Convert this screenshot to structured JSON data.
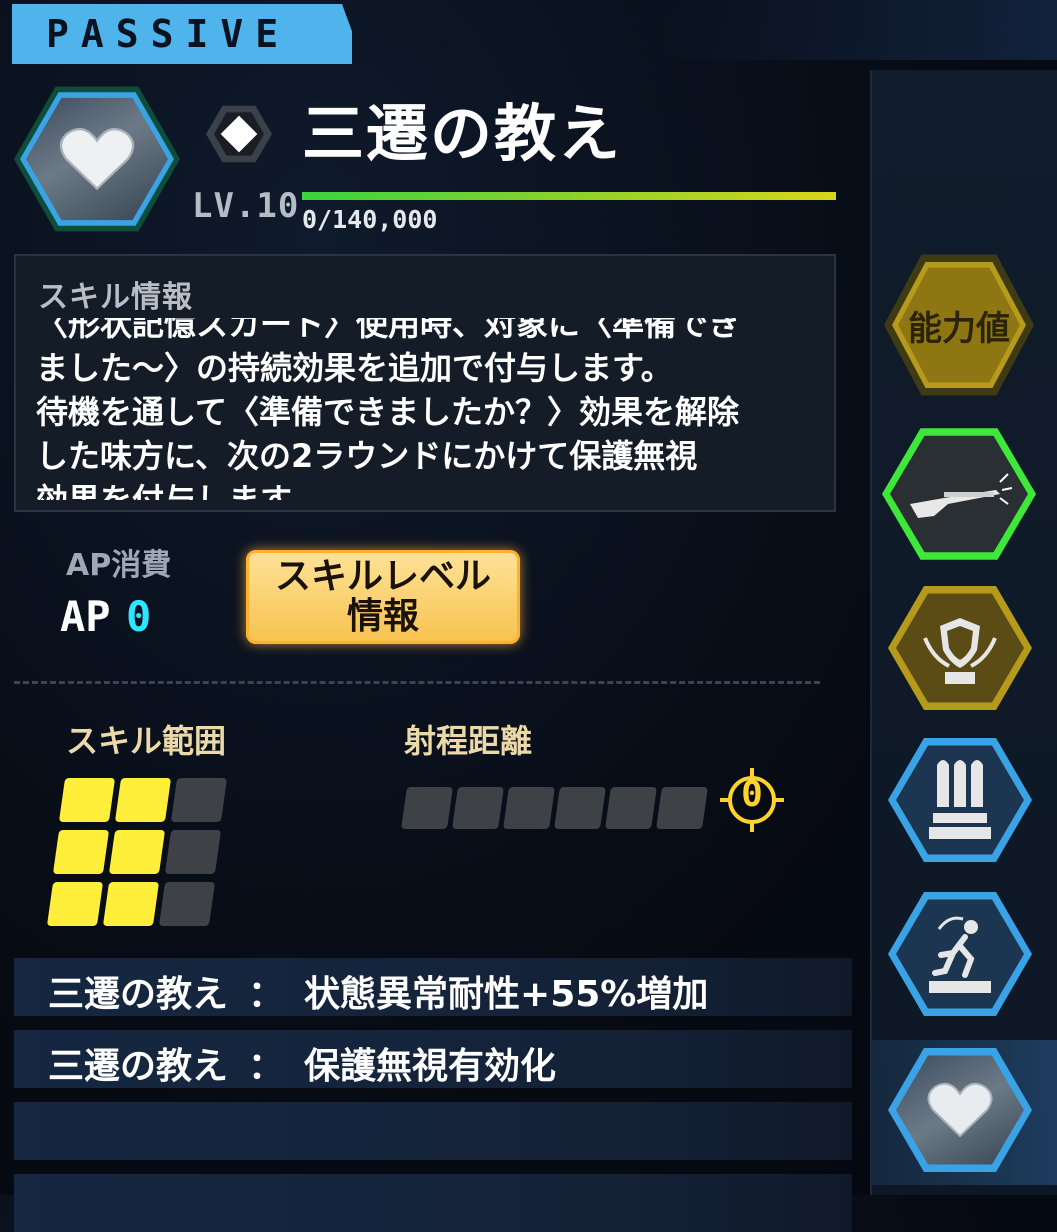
{
  "header": {
    "tab_label": "PASSIVE"
  },
  "skill": {
    "name": "三遷の教え",
    "level": "LV.10",
    "exp_text": "0/140,000",
    "exp_progress": 0
  },
  "info": {
    "title": "スキル情報",
    "lines": [
      "〈形状記憶スカート〉使用時、対象に〈準備でき",
      "ました〜〉の持続効果を追加で付与します。",
      "待機を通して〈準備できましたか？〉効果を解除",
      "した味方に、次の2ラウンドにかけて保護無視",
      "効果を付与します。"
    ]
  },
  "ap": {
    "label": "AP消費",
    "prefix": "AP",
    "value": "0"
  },
  "level_info_button": "スキルレベル情報",
  "range": {
    "label": "スキル範囲",
    "grid": [
      [
        1,
        1,
        0
      ],
      [
        1,
        1,
        0
      ],
      [
        1,
        1,
        0
      ]
    ]
  },
  "distance": {
    "label": "射程距離",
    "cells": 6,
    "value": "0"
  },
  "effects": [
    {
      "name": "三遷の教え",
      "sep": "：",
      "desc": "状態異常耐性+55%増加"
    },
    {
      "name": "三遷の教え",
      "sep": "：",
      "desc": "保護無視有効化"
    },
    {
      "name": "",
      "sep": "",
      "desc": ""
    },
    {
      "name": "",
      "sep": "",
      "desc": ""
    }
  ],
  "sidebar": {
    "items": [
      {
        "label": "能力値",
        "icon": "stats-icon",
        "color": "#b59a1c"
      },
      {
        "label": "",
        "icon": "shotgun-icon",
        "color": "#3ee83a"
      },
      {
        "label": "",
        "icon": "shield-wings-icon",
        "color": "#b59a1c"
      },
      {
        "label": "",
        "icon": "bullets-icon",
        "color": "#3aa3e6"
      },
      {
        "label": "",
        "icon": "running-icon",
        "color": "#3aa3e6"
      },
      {
        "label": "",
        "icon": "heart-icon",
        "color": "#3aa3e6"
      }
    ]
  },
  "colors": {
    "accent": "#4fb4ec",
    "range_on": "#ffef3a",
    "ap_value": "#2ee4ff",
    "button": "#f7c24d"
  }
}
